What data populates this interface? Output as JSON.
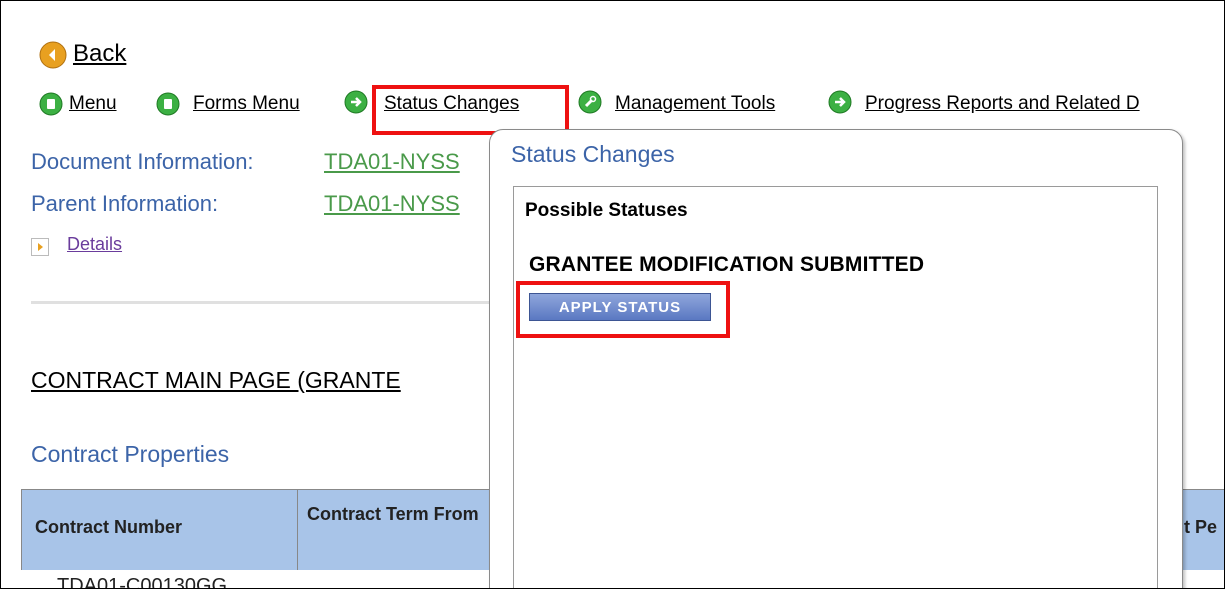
{
  "nav": {
    "back": "Back",
    "items": [
      {
        "label": "Menu"
      },
      {
        "label": "Forms Menu"
      },
      {
        "label": "Status Changes"
      },
      {
        "label": "Management Tools"
      },
      {
        "label": "Progress Reports and Related D"
      }
    ]
  },
  "document": {
    "doc_label": "Document Information:",
    "doc_value": "TDA01-NYSS",
    "parent_label": "Parent Information:",
    "parent_value": "TDA01-NYSS",
    "details": "Details"
  },
  "page": {
    "heading": "CONTRACT MAIN PAGE (GRANTE",
    "section_title": "Contract Properties"
  },
  "table": {
    "headers": [
      "Contract Number",
      "Contract Term From",
      "t Pe"
    ],
    "first_cell_partial": "TDA01-C00130GG"
  },
  "popup": {
    "title": "Status Changes",
    "possible_label": "Possible Statuses",
    "status_name": "GRANTEE MODIFICATION SUBMITTED",
    "apply_button": "APPLY STATUS"
  },
  "colors": {
    "highlight": "#ee1111",
    "link_blue": "#3c64a8",
    "link_green": "#4a9a4a",
    "table_header": "#a8c4e8"
  }
}
